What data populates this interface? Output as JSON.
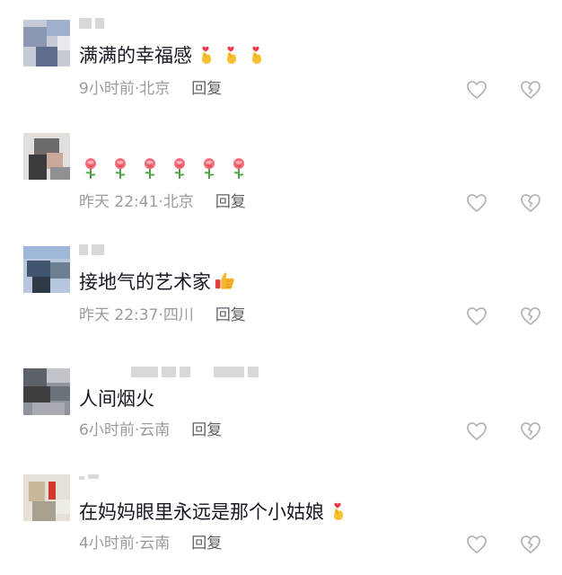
{
  "comments": [
    {
      "text": "满满的幸福感",
      "emoji": "finger-heart",
      "emoji_count": 3,
      "time": "9小时前",
      "location": "北京",
      "reply": "回复"
    },
    {
      "text": "",
      "emoji": "rose",
      "emoji_count": 6,
      "time": "昨天 22:41",
      "location": "北京",
      "reply": "回复"
    },
    {
      "text": "接地气的艺术家",
      "emoji": "thumbs-up",
      "emoji_count": 1,
      "time": "昨天 22:37",
      "location": "四川",
      "reply": "回复"
    },
    {
      "text": "人间烟火",
      "emoji": "",
      "emoji_count": 0,
      "time": "6小时前",
      "location": "云南",
      "reply": "回复"
    },
    {
      "text": "在妈妈眼里永远是那个小姑娘",
      "emoji": "finger-heart",
      "emoji_count": 1,
      "time": "4小时前",
      "location": "云南",
      "reply": "回复"
    }
  ],
  "separator": "·",
  "icons": {
    "like": "heart-outline-icon",
    "dislike": "broken-heart-icon"
  },
  "colors": {
    "text": "#161823",
    "meta": "#9a9ba1",
    "reply": "#5f6069",
    "icon": "#b4b5ba"
  }
}
